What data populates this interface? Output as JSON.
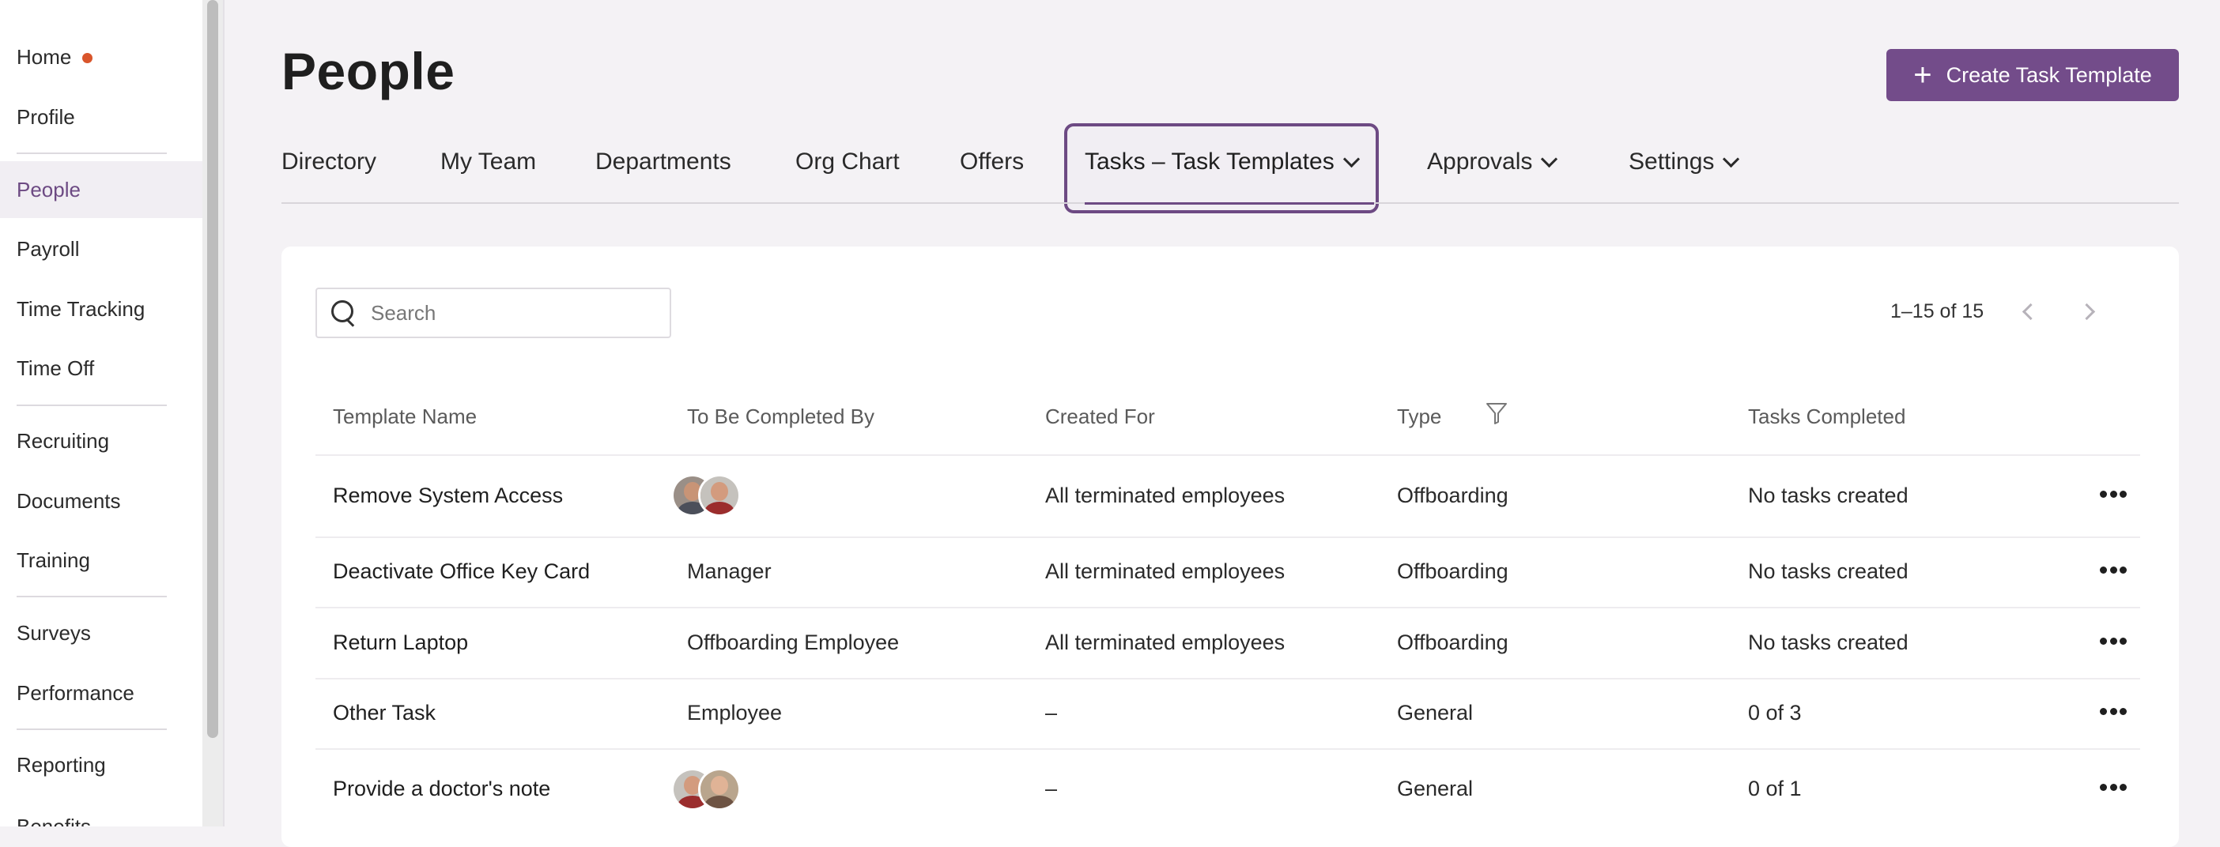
{
  "sidebar": {
    "items": [
      {
        "label": "Home",
        "badge": "dot"
      },
      {
        "label": "Profile"
      },
      {
        "label": "People",
        "active": true
      },
      {
        "label": "Payroll"
      },
      {
        "label": "Time Tracking"
      },
      {
        "label": "Time Off"
      },
      {
        "label": "Recruiting"
      },
      {
        "label": "Documents"
      },
      {
        "label": "Training"
      },
      {
        "label": "Surveys"
      },
      {
        "label": "Performance"
      },
      {
        "label": "Reporting"
      },
      {
        "label": "Benefits"
      }
    ]
  },
  "header": {
    "title": "People",
    "create_button_label": "Create Task Template",
    "create_button_icon": "plus-icon"
  },
  "tabs": [
    {
      "label": "Directory"
    },
    {
      "label": "My Team"
    },
    {
      "label": "Departments"
    },
    {
      "label": "Org Chart"
    },
    {
      "label": "Offers"
    },
    {
      "label": "Tasks – Task Templates",
      "active": true,
      "dropdown": true
    },
    {
      "label": "Approvals",
      "dropdown": true
    },
    {
      "label": "Settings",
      "dropdown": true
    }
  ],
  "search": {
    "placeholder": "Search",
    "value": ""
  },
  "pagination": {
    "text": "1–15 of 15"
  },
  "table": {
    "columns": [
      "Template Name",
      "To Be Completed By",
      "Created For",
      "Type",
      "Tasks Completed"
    ],
    "rows": [
      {
        "name": "Remove System Access",
        "completed_by": "",
        "completed_by_avatars": [
          "avatar-man-beard",
          "avatar-man-smile"
        ],
        "created_for": "All terminated employees",
        "type": "Offboarding",
        "tasks": "No tasks created"
      },
      {
        "name": "Deactivate Office Key Card",
        "completed_by": "Manager",
        "created_for": "All terminated employees",
        "type": "Offboarding",
        "tasks": "No tasks created"
      },
      {
        "name": "Return Laptop",
        "completed_by": "Offboarding Employee",
        "created_for": "All terminated employees",
        "type": "Offboarding",
        "tasks": "No tasks created"
      },
      {
        "name": "Other Task",
        "completed_by": "Employee",
        "created_for": "–",
        "type": "General",
        "tasks": "0 of 3"
      },
      {
        "name": "Provide a doctor's note",
        "completed_by": "",
        "completed_by_avatars": [
          "avatar-man-smile",
          "avatar-woman"
        ],
        "created_for": "–",
        "type": "General",
        "tasks": "0 of 1"
      }
    ]
  },
  "colors": {
    "accent": "#734c8a",
    "notification_dot": "#d9552b"
  }
}
